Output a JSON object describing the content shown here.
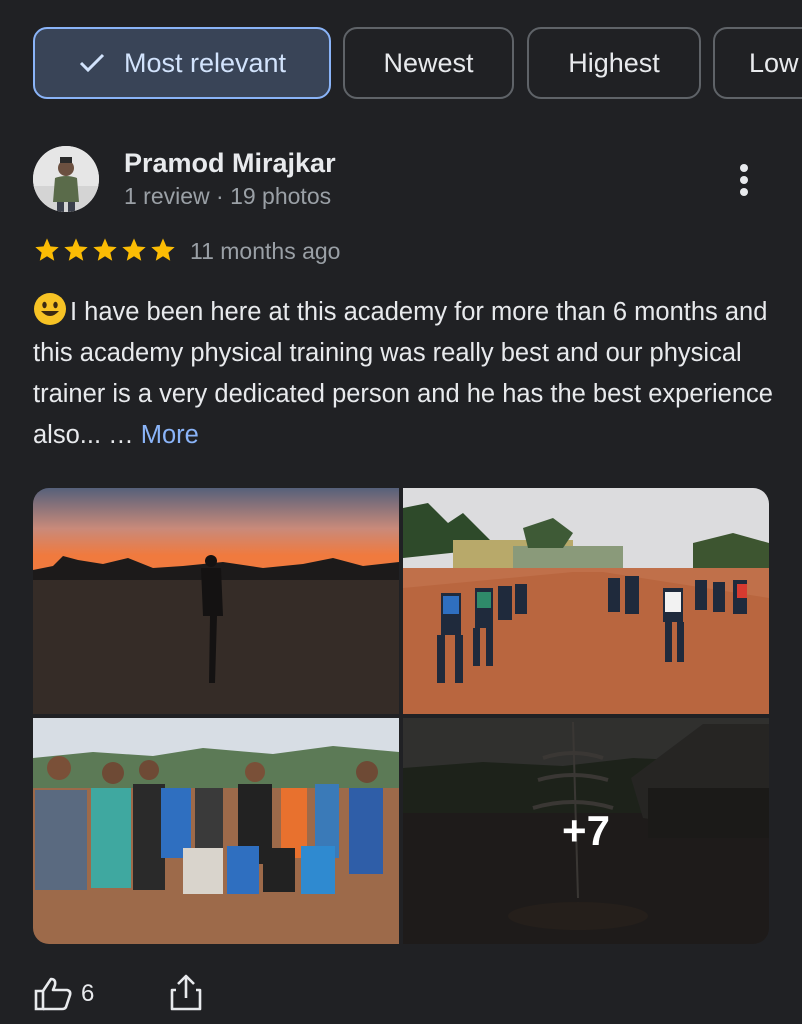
{
  "filters": [
    {
      "label": "Most relevant",
      "selected": true
    },
    {
      "label": "Newest",
      "selected": false
    },
    {
      "label": "Highest",
      "selected": false
    },
    {
      "label": "Low",
      "selected": false
    }
  ],
  "review": {
    "author": "Pramod Mirajkar",
    "author_meta": "1 review · 19 photos",
    "rating": 5,
    "time_ago": "11 months ago",
    "text": "I have been here at this academy for more than 6 months and this academy physical training was really best and our physical trainer is a very dedicated person and he has the best experience also... … ",
    "more_label": "More",
    "extra_photos_label": "+7",
    "likes": "6"
  },
  "colors": {
    "background": "#202124",
    "accent": "#8ab4f8",
    "selected_chip_bg": "#394457",
    "star": "#fbbc04"
  },
  "icons": [
    "check-icon",
    "more-vert-icon",
    "star-icon",
    "emoji-icon",
    "thumbs-up-icon",
    "share-icon"
  ]
}
